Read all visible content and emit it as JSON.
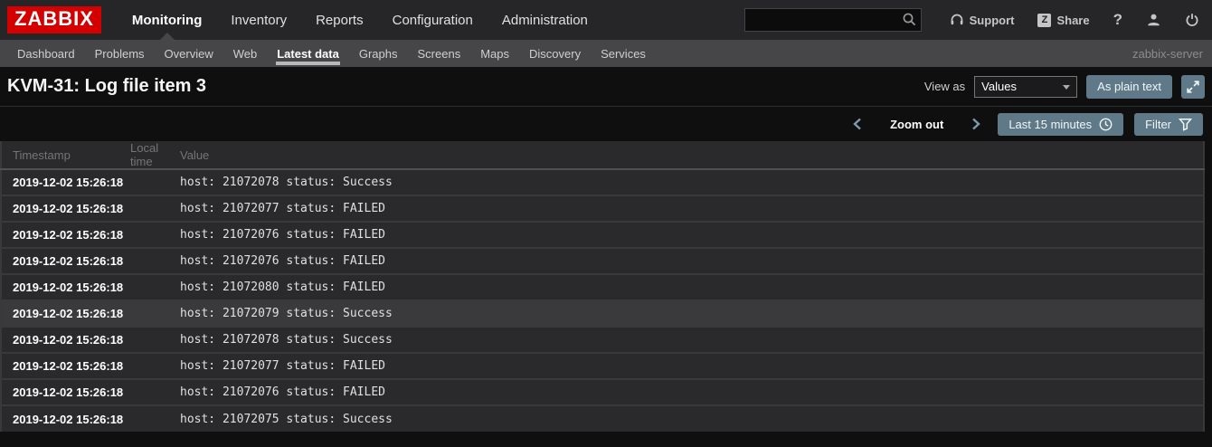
{
  "brand": {
    "logo_text": "ZABBIX"
  },
  "topnav": {
    "items": [
      {
        "label": "Monitoring",
        "active": true
      },
      {
        "label": "Inventory"
      },
      {
        "label": "Reports"
      },
      {
        "label": "Configuration"
      },
      {
        "label": "Administration"
      }
    ]
  },
  "topbar_right": {
    "search_value": "",
    "support_label": "Support",
    "share_badge": "Z",
    "share_label": "Share",
    "help_label": "?"
  },
  "subnav": {
    "items": [
      {
        "label": "Dashboard"
      },
      {
        "label": "Problems"
      },
      {
        "label": "Overview"
      },
      {
        "label": "Web"
      },
      {
        "label": "Latest data",
        "active": true
      },
      {
        "label": "Graphs"
      },
      {
        "label": "Screens"
      },
      {
        "label": "Maps"
      },
      {
        "label": "Discovery"
      },
      {
        "label": "Services"
      }
    ],
    "server_label": "zabbix-server"
  },
  "page_header": {
    "title": "KVM-31: Log file item 3",
    "view_as_label": "View as",
    "view_as_value": "Values",
    "as_plain_text_label": "As plain text"
  },
  "time_controls": {
    "zoom_out_label": "Zoom out",
    "range_label": "Last 15 minutes",
    "filter_label": "Filter"
  },
  "table": {
    "columns": [
      "Timestamp",
      "Local time",
      "Value"
    ],
    "rows": [
      {
        "timestamp": "2019-12-02 15:26:18",
        "local_time": "",
        "value": "host: 21072078 status: Success"
      },
      {
        "timestamp": "2019-12-02 15:26:18",
        "local_time": "",
        "value": "host: 21072077 status: FAILED"
      },
      {
        "timestamp": "2019-12-02 15:26:18",
        "local_time": "",
        "value": "host: 21072076 status: FAILED"
      },
      {
        "timestamp": "2019-12-02 15:26:18",
        "local_time": "",
        "value": "host: 21072076 status: FAILED"
      },
      {
        "timestamp": "2019-12-02 15:26:18",
        "local_time": "",
        "value": "host: 21072080 status: FAILED"
      },
      {
        "timestamp": "2019-12-02 15:26:18",
        "local_time": "",
        "value": "host: 21072079 status: Success",
        "highlighted": true
      },
      {
        "timestamp": "2019-12-02 15:26:18",
        "local_time": "",
        "value": "host: 21072078 status: Success"
      },
      {
        "timestamp": "2019-12-02 15:26:18",
        "local_time": "",
        "value": "host: 21072077 status: FAILED"
      },
      {
        "timestamp": "2019-12-02 15:26:18",
        "local_time": "",
        "value": "host: 21072076 status: FAILED"
      },
      {
        "timestamp": "2019-12-02 15:26:18",
        "local_time": "",
        "value": "host: 21072075 status: Success"
      }
    ]
  },
  "colors": {
    "brand_red": "#d40000",
    "accent_slate": "#5f7988",
    "row_hover": "#3a3a3d"
  }
}
